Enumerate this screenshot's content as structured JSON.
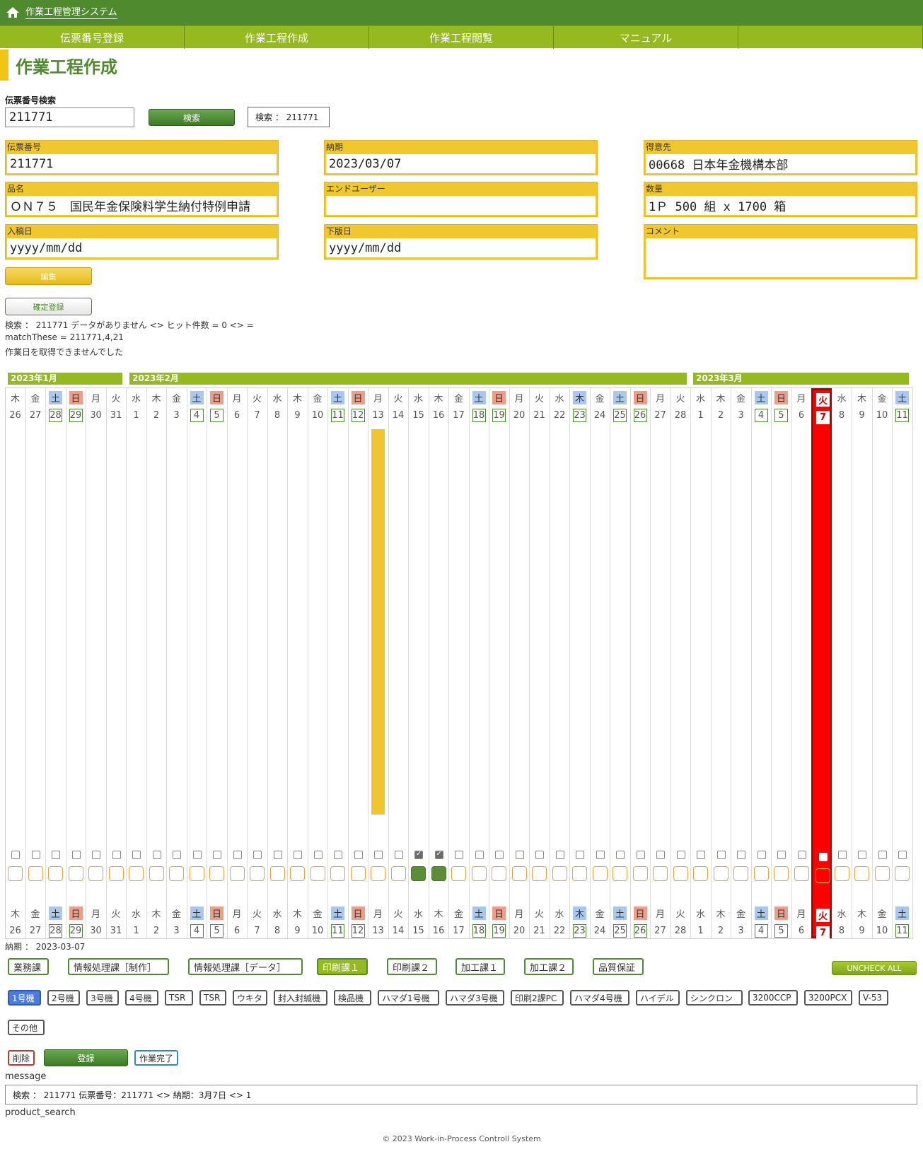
{
  "app": {
    "title": "作業工程管理システム"
  },
  "nav": [
    "伝票番号登録",
    "作業工程作成",
    "作業工程閲覧",
    "マニュアル"
  ],
  "page_title": "作業工程作成",
  "search": {
    "label": "伝票番号検索",
    "value": "211771",
    "button": "検索",
    "result": "検索 ： 211771"
  },
  "fields": {
    "denpyo": {
      "label": "伝票番号",
      "value": "211771"
    },
    "nouki": {
      "label": "納期",
      "value": "2023/03/07"
    },
    "tokuisaki": {
      "label": "得意先",
      "value": "00668 日本年金機構本部"
    },
    "hinmei": {
      "label": "品名",
      "value": "ＯＮ７５　国民年金保険料学生納付特例申請"
    },
    "enduser": {
      "label": "エンドユーザー",
      "value": ""
    },
    "suryo": {
      "label": "数量",
      "value": "1Ｐ 500 組 x 1700 箱"
    },
    "nyukou": {
      "label": "入稿日",
      "value": "yyyy/mm/dd"
    },
    "hanko": {
      "label": "下版日",
      "value": "yyyy/mm/dd"
    },
    "comment": {
      "label": "コメント",
      "value": ""
    }
  },
  "buttons": {
    "edit": "編集",
    "confirm": "確定登録",
    "uncheck_all": "UNCHECK ALL",
    "delete": "削除",
    "register": "登録",
    "complete": "作業完了"
  },
  "messages": [
    "検索 ： 211771 データがありません <> ヒット件数 = 0 <> =",
    "matchThese = 211771,4,21",
    "作業日を取得できませんでした"
  ],
  "months": [
    "2023年1月",
    "2023年2月",
    "2023年3月"
  ],
  "calendar": [
    {
      "dw": "木",
      "d": "26",
      "t": ""
    },
    {
      "dw": "金",
      "d": "27",
      "t": ""
    },
    {
      "dw": "土",
      "d": "28",
      "t": "sat"
    },
    {
      "dw": "日",
      "d": "29",
      "t": "sun"
    },
    {
      "dw": "月",
      "d": "30",
      "t": ""
    },
    {
      "dw": "火",
      "d": "31",
      "t": ""
    },
    {
      "dw": "水",
      "d": "1",
      "t": ""
    },
    {
      "dw": "木",
      "d": "2",
      "t": ""
    },
    {
      "dw": "金",
      "d": "3",
      "t": ""
    },
    {
      "dw": "土",
      "d": "4",
      "t": "sat"
    },
    {
      "dw": "日",
      "d": "5",
      "t": "sun"
    },
    {
      "dw": "月",
      "d": "6",
      "t": ""
    },
    {
      "dw": "火",
      "d": "7",
      "t": ""
    },
    {
      "dw": "水",
      "d": "8",
      "t": ""
    },
    {
      "dw": "木",
      "d": "9",
      "t": ""
    },
    {
      "dw": "金",
      "d": "10",
      "t": ""
    },
    {
      "dw": "土",
      "d": "11",
      "t": "sat"
    },
    {
      "dw": "日",
      "d": "12",
      "t": "sun"
    },
    {
      "dw": "月",
      "d": "13",
      "t": "",
      "bar": true
    },
    {
      "dw": "火",
      "d": "14",
      "t": ""
    },
    {
      "dw": "水",
      "d": "15",
      "t": "",
      "checked": true,
      "filled": true
    },
    {
      "dw": "木",
      "d": "16",
      "t": "",
      "checked": true,
      "filled": true
    },
    {
      "dw": "金",
      "d": "17",
      "t": ""
    },
    {
      "dw": "土",
      "d": "18",
      "t": "sat"
    },
    {
      "dw": "日",
      "d": "19",
      "t": "sun"
    },
    {
      "dw": "月",
      "d": "20",
      "t": ""
    },
    {
      "dw": "火",
      "d": "21",
      "t": ""
    },
    {
      "dw": "水",
      "d": "22",
      "t": ""
    },
    {
      "dw": "木",
      "d": "23",
      "t": "sat"
    },
    {
      "dw": "金",
      "d": "24",
      "t": ""
    },
    {
      "dw": "土",
      "d": "25",
      "t": "sat"
    },
    {
      "dw": "日",
      "d": "26",
      "t": "sun"
    },
    {
      "dw": "月",
      "d": "27",
      "t": ""
    },
    {
      "dw": "火",
      "d": "28",
      "t": ""
    },
    {
      "dw": "水",
      "d": "1",
      "t": ""
    },
    {
      "dw": "木",
      "d": "2",
      "t": ""
    },
    {
      "dw": "金",
      "d": "3",
      "t": ""
    },
    {
      "dw": "土",
      "d": "4",
      "t": "sat"
    },
    {
      "dw": "日",
      "d": "5",
      "t": "sun"
    },
    {
      "dw": "月",
      "d": "6",
      "t": ""
    },
    {
      "dw": "火",
      "d": "7",
      "t": "",
      "today": true
    },
    {
      "dw": "水",
      "d": "8",
      "t": ""
    },
    {
      "dw": "木",
      "d": "9",
      "t": ""
    },
    {
      "dw": "金",
      "d": "10",
      "t": ""
    },
    {
      "dw": "土",
      "d": "11",
      "t": "sat"
    }
  ],
  "nouki_line": "納期 ： 2023-03-07",
  "departments": [
    "業務課",
    "情報処理課［制作］",
    "情報処理課［データ］",
    "印刷課１",
    "印刷課２",
    "加工課１",
    "加工課２",
    "品質保証"
  ],
  "active_department": "印刷課１",
  "machines": [
    "1号機",
    "2号機",
    "3号機",
    "4号機",
    "TSR",
    "TSR",
    "ウキタ",
    "封入封緘機",
    "検品機",
    "ハマダ1号機",
    "ハマダ3号機",
    "印刷2課PC",
    "ハマダ4号機",
    "ハイデル",
    "シンクロン",
    "3200CCP",
    "3200PCX",
    "V-53",
    "その他"
  ],
  "active_machine": "1号機",
  "message_label": "message",
  "message_text": "検索 ： 211771 伝票番号：211771 <> 納期：3月7日 <> 1",
  "product_search_label": "product_search",
  "footer": "© 2023 Work-in-Process Controll System"
}
